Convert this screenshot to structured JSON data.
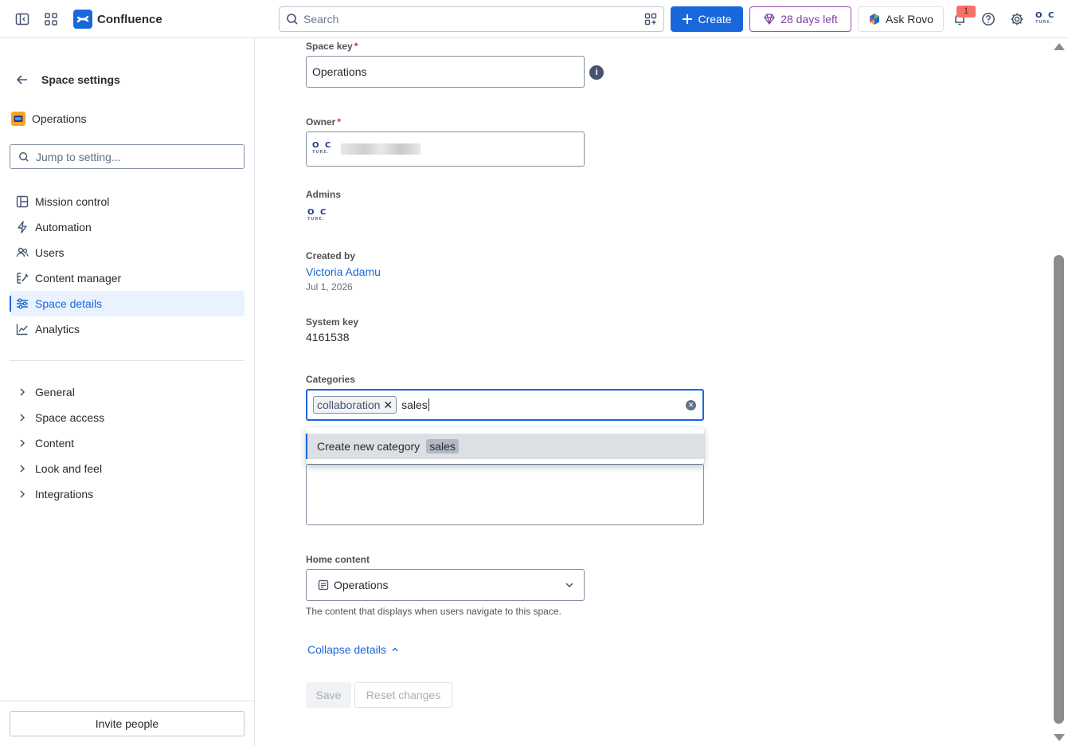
{
  "topbar": {
    "app_name": "Confluence",
    "search_placeholder": "Search",
    "create_label": "Create",
    "trial_label": "28 days left",
    "rovo_label": "Ask Rovo",
    "notification_count": "1"
  },
  "sidebar": {
    "title": "Space settings",
    "space_name": "Operations",
    "jump_placeholder": "Jump to setting...",
    "items": [
      {
        "label": "Mission control",
        "icon": "layout-icon"
      },
      {
        "label": "Automation",
        "icon": "lightning-icon"
      },
      {
        "label": "Users",
        "icon": "users-icon"
      },
      {
        "label": "Content manager",
        "icon": "content-manager-icon"
      },
      {
        "label": "Space details",
        "icon": "sliders-icon",
        "active": true
      },
      {
        "label": "Analytics",
        "icon": "chart-icon"
      }
    ],
    "groups": [
      "General",
      "Space access",
      "Content",
      "Look and feel",
      "Integrations"
    ],
    "invite_label": "Invite people"
  },
  "form": {
    "space_key_label": "Space key",
    "space_key_value": "Operations",
    "owner_label": "Owner",
    "admins_label": "Admins",
    "created_by_label": "Created by",
    "created_by_name": "Victoria Adamu",
    "created_date": "Jul 1, 2026",
    "system_key_label": "System key",
    "system_key_value": "4161538",
    "categories_label": "Categories",
    "category_tag": "collaboration",
    "category_typed": "sales",
    "dropdown_option": "Create new category",
    "dropdown_chip": "sales",
    "home_content_label": "Home content",
    "home_content_value": "Operations",
    "home_content_help": "The content that displays when users navigate to this space.",
    "collapse_label": "Collapse details",
    "save_label": "Save",
    "reset_label": "Reset changes",
    "avatar_text": "O C",
    "avatar_sub": "TURE."
  },
  "colors": {
    "accent": "#1868db",
    "trial": "#803fa5",
    "required": "#c9372c"
  }
}
